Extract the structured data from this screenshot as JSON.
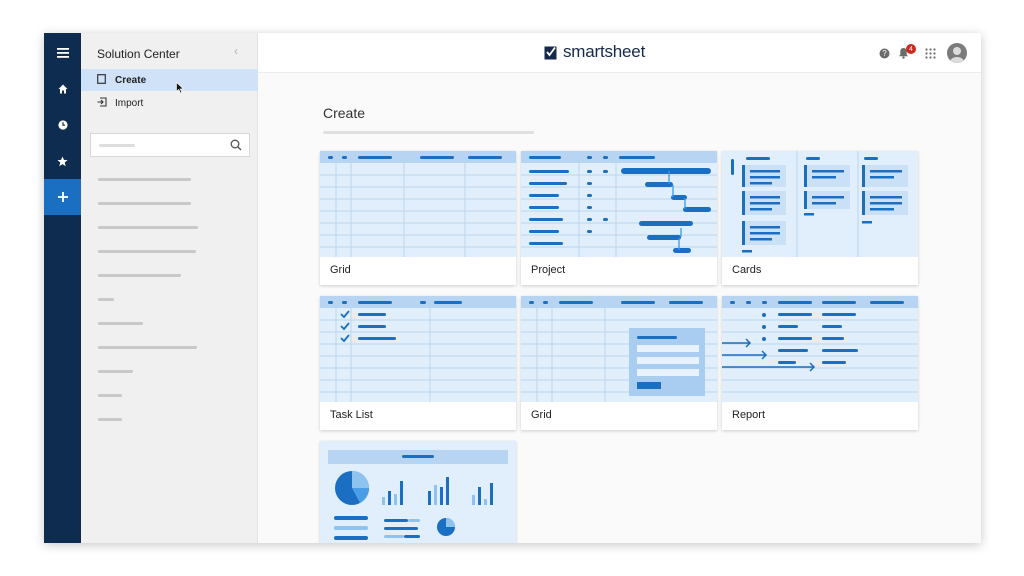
{
  "sidebar": {
    "title": "Solution Center",
    "items": [
      {
        "label": "Create",
        "icon": "document-icon",
        "selected": true
      },
      {
        "label": "Import",
        "icon": "import-icon",
        "selected": false
      }
    ],
    "search": {
      "placeholder": ""
    }
  },
  "rail": {
    "items": [
      "menu-icon",
      "home-icon",
      "clock-icon",
      "star-icon",
      "plus-icon"
    ]
  },
  "header": {
    "brand": "smartsheet",
    "notification_count": "4"
  },
  "main": {
    "heading": "Create",
    "cards": [
      {
        "label": "Grid",
        "thumb": "grid"
      },
      {
        "label": "Project",
        "thumb": "project"
      },
      {
        "label": "Cards",
        "thumb": "cards"
      },
      {
        "label": "Task List",
        "thumb": "tasklist"
      },
      {
        "label": "Grid",
        "thumb": "form"
      },
      {
        "label": "Report",
        "thumb": "report"
      },
      {
        "label": "",
        "thumb": "dashboard"
      }
    ]
  },
  "colors": {
    "rail": "#0d2c50",
    "accent": "#1b6fc2",
    "thumb_bg": "#e1eefb",
    "badge": "#d0271d"
  }
}
